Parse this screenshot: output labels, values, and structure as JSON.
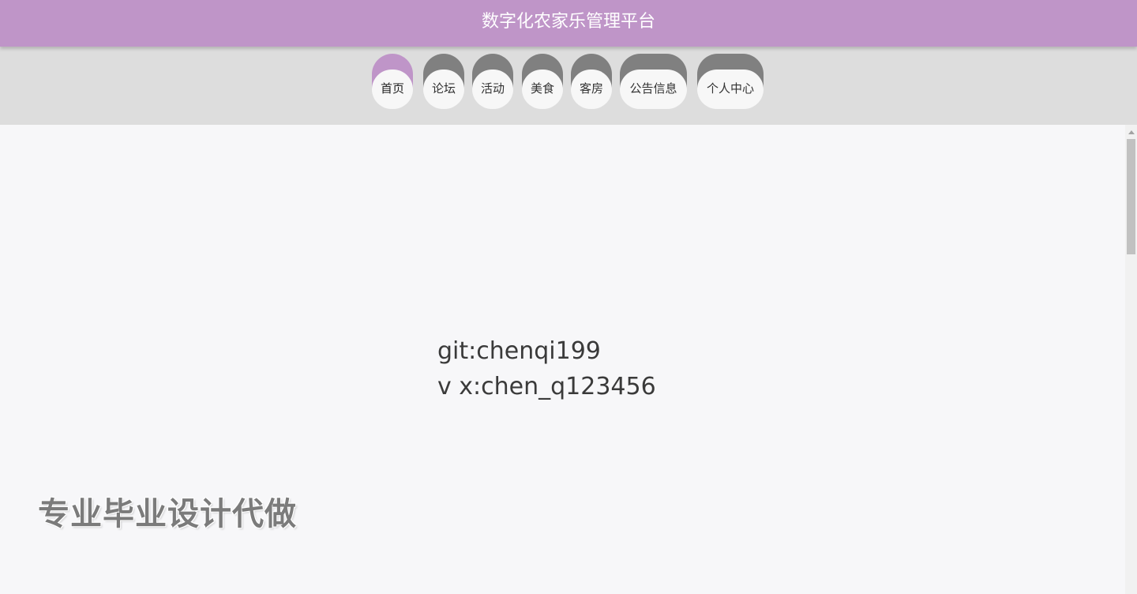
{
  "header": {
    "title": "数字化农家乐管理平台"
  },
  "nav": {
    "items": [
      {
        "label": "首页",
        "active": true
      },
      {
        "label": "论坛",
        "active": false
      },
      {
        "label": "活动",
        "active": false
      },
      {
        "label": "美食",
        "active": false
      },
      {
        "label": "客房",
        "active": false
      },
      {
        "label": "公告信息",
        "active": false
      },
      {
        "label": "个人中心",
        "active": false
      }
    ]
  },
  "main": {
    "contact_line1": "git:chenqi199",
    "contact_line2": "v x:chen_q123456",
    "watermark": "专业毕业设计代做"
  },
  "colors": {
    "accent": "#bf95c8",
    "nav_background": "#dddddd",
    "nav_inactive_cap": "#808080",
    "page_background": "#f7f7f9"
  }
}
